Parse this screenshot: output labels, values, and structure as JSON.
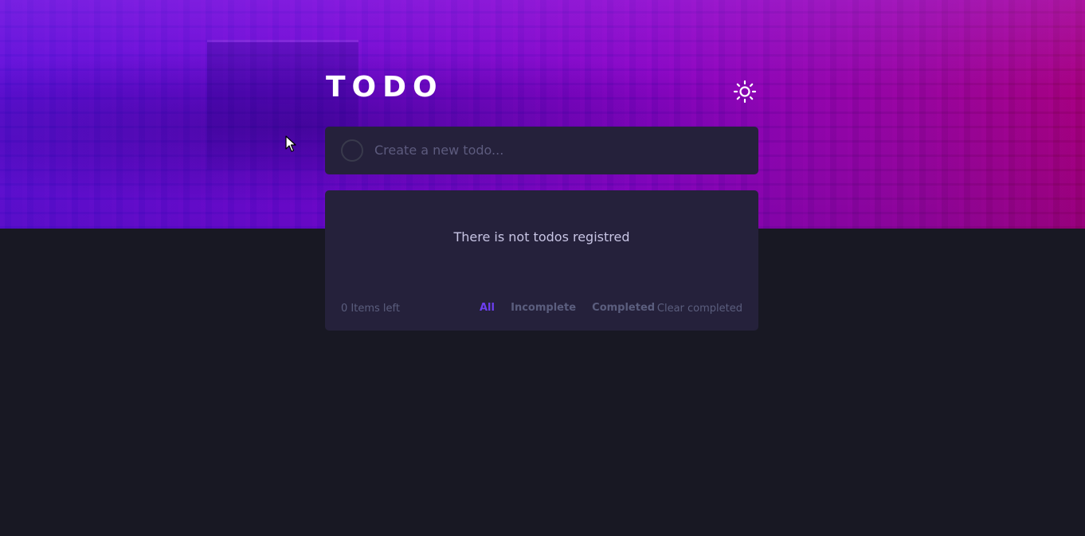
{
  "header": {
    "title": "TODO",
    "theme_toggle_icon": "sun-icon"
  },
  "new_todo": {
    "placeholder": "Create a new todo...",
    "value": ""
  },
  "list": {
    "empty_message": "There is not todos registred"
  },
  "footer": {
    "items_left": "0 Items left",
    "filters": [
      {
        "label": "All",
        "active": true
      },
      {
        "label": "Incomplete",
        "active": false
      },
      {
        "label": "Completed",
        "active": false
      }
    ],
    "clear_label": "Clear completed"
  },
  "colors": {
    "accent": "#6d3ff0",
    "card_bg": "#25213b",
    "page_bg": "#181823",
    "muted_text": "#5b5e7e"
  }
}
